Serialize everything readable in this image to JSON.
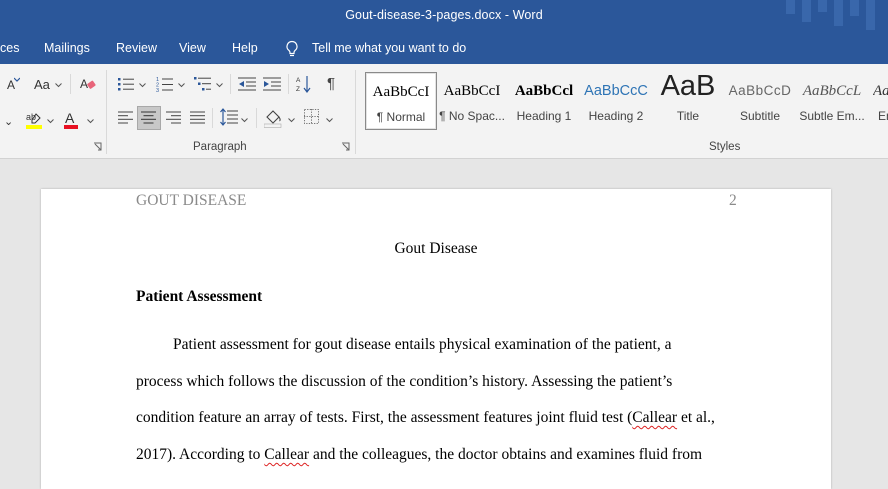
{
  "window": {
    "title": "Gout-disease-3-pages.docx  -  Word"
  },
  "menu": {
    "items": [
      "ces",
      "Mailings",
      "Review",
      "View",
      "Help"
    ],
    "tell_me": "Tell me what you want to do"
  },
  "ribbon": {
    "font": {
      "size_label_a": "A",
      "case_label": "Aa"
    },
    "paragraph": {
      "label": "Paragraph"
    },
    "styles": {
      "label": "Styles",
      "items": [
        {
          "preview": "AaBbCcI",
          "name": "¶ Normal"
        },
        {
          "preview": "AaBbCcI",
          "name": "¶ No Spac..."
        },
        {
          "preview": "AaBbCcl",
          "name": "Heading 1"
        },
        {
          "preview": "AaBbCcC",
          "name": "Heading 2"
        },
        {
          "preview": "AaB",
          "name": "Title"
        },
        {
          "preview": "AaBbCcD",
          "name": "Subtitle"
        },
        {
          "preview": "AaBbCcL",
          "name": "Subtle Em..."
        },
        {
          "preview": "Aa",
          "name": "En"
        }
      ]
    },
    "colors": {
      "highlight": "#ffff00",
      "font_color": "#e81123"
    }
  },
  "document": {
    "header_left": "GOUT DISEASE",
    "header_right": "2",
    "title": "Gout Disease",
    "heading": "Patient Assessment",
    "lines": [
      {
        "a": "Patient assessment for gout disease entails physical examination of the patient, a"
      },
      {
        "a": "process which follows the discussion of the condition’s history. Assessing the patient’s"
      },
      {
        "a": "condition feature an array of tests. First, the assessment features joint fluid test (",
        "sq": "Callear",
        "b": " et al.,"
      },
      {
        "a": "2017). According to ",
        "sq": "Callear",
        "b": " and the colleagues, the doctor obtains and examines fluid from"
      }
    ]
  }
}
